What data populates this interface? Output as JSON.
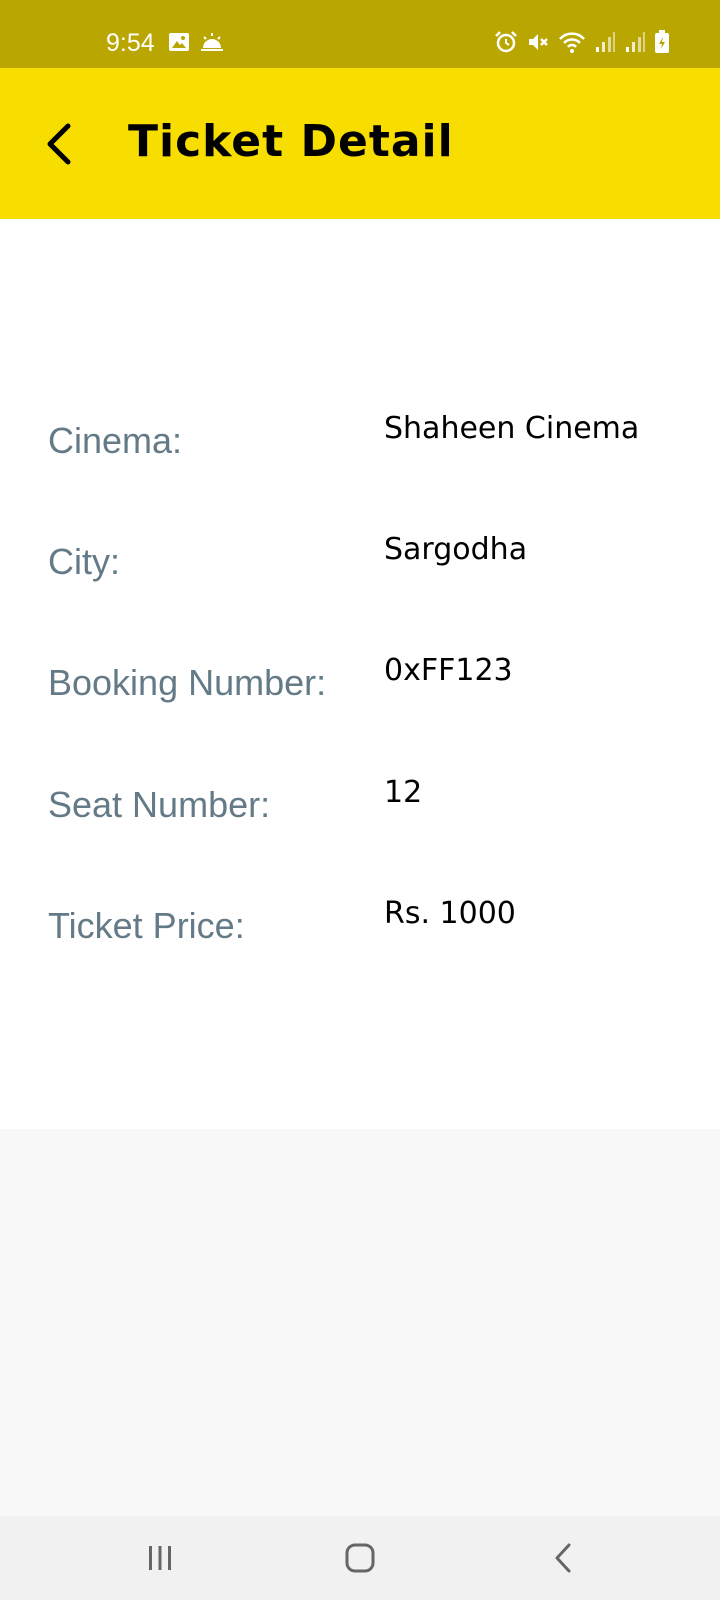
{
  "status_bar": {
    "time": "9:54",
    "left_icons": [
      "image-icon",
      "weather-icon"
    ],
    "right_icons": [
      "alarm-icon",
      "mute-icon",
      "wifi-icon",
      "signal-icon",
      "signal-icon",
      "battery-icon"
    ]
  },
  "app_bar": {
    "title": "Ticket Detail",
    "background": "#f7dd00"
  },
  "details": [
    {
      "label": "Cinema:",
      "value": "Shaheen Cinema"
    },
    {
      "label": "City:",
      "value": "Sargodha"
    },
    {
      "label": "Booking Number:",
      "value": "0xFF123"
    },
    {
      "label": "Seat Number:",
      "value": "12"
    },
    {
      "label": "Ticket Price:",
      "value": "Rs. 1000"
    }
  ],
  "nav_bar": {
    "buttons": [
      "recents-icon",
      "home-icon",
      "back-icon"
    ]
  }
}
